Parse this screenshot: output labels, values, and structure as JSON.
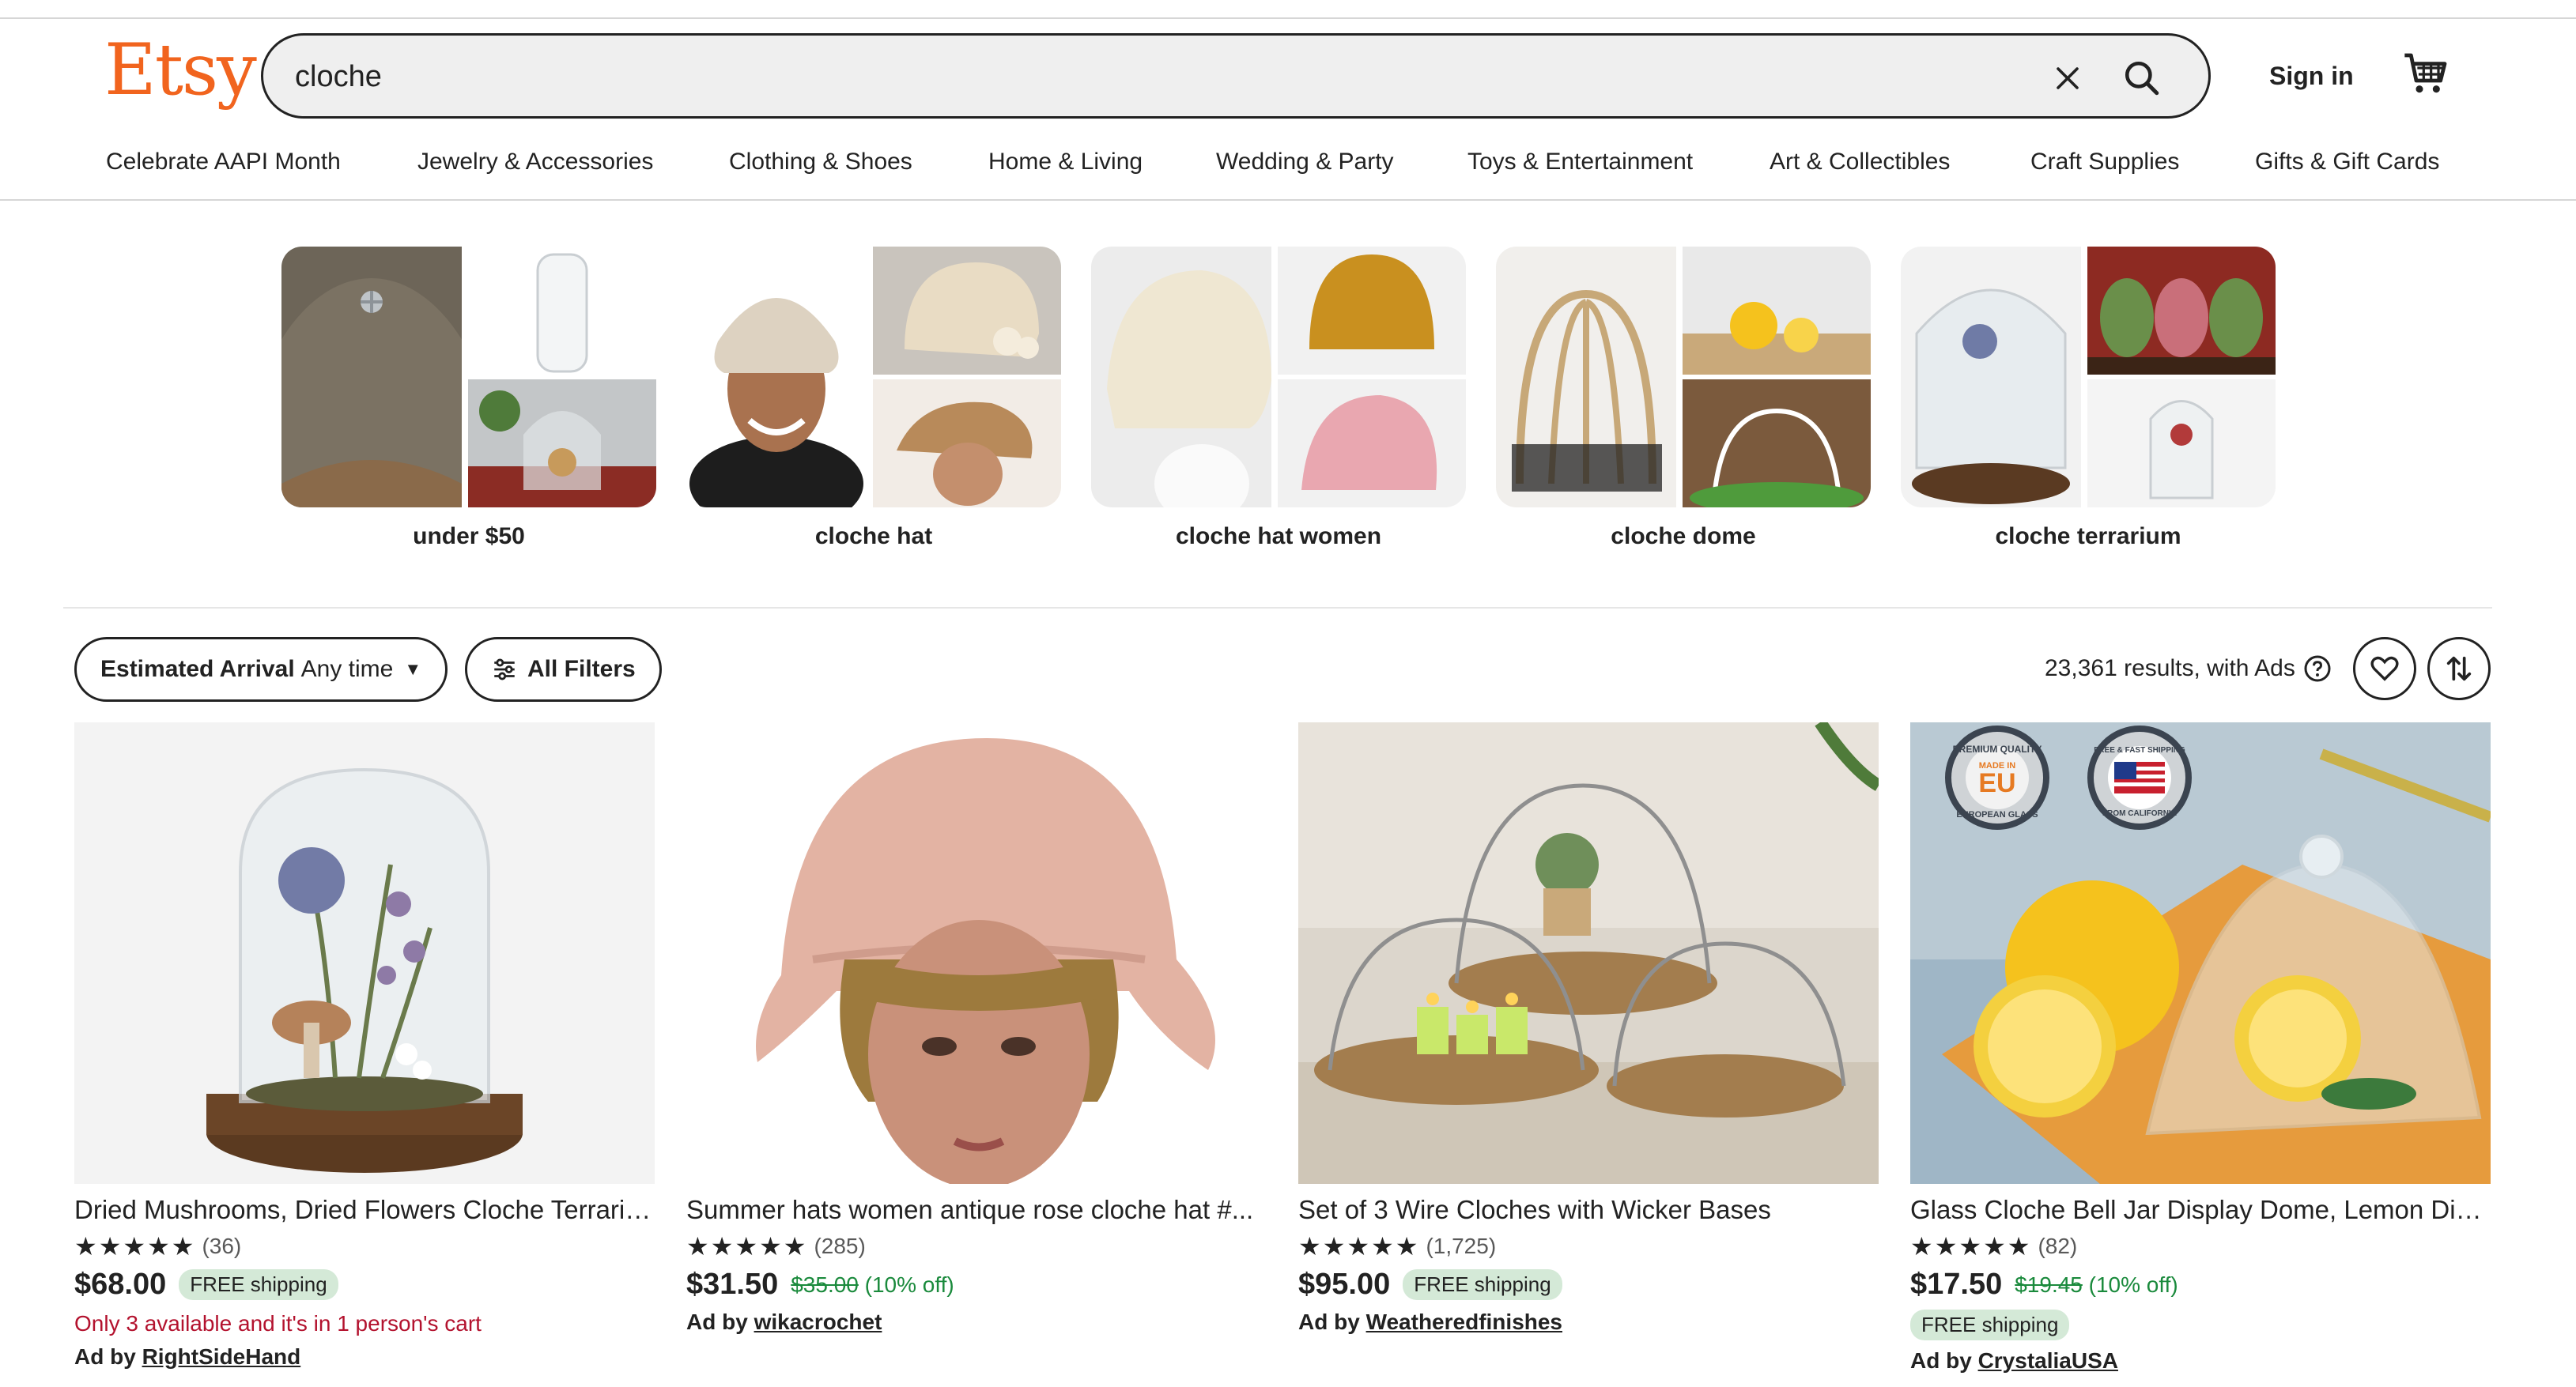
{
  "header": {
    "logo": "Etsy",
    "search_value": "cloche",
    "signin_label": "Sign in"
  },
  "categories": [
    "Celebrate AAPI Month",
    "Jewelry & Accessories",
    "Clothing & Shoes",
    "Home & Living",
    "Wedding & Party",
    "Toys & Entertainment",
    "Art & Collectibles",
    "Craft Supplies",
    "Gifts & Gift Cards"
  ],
  "related": [
    {
      "label": "under $50"
    },
    {
      "label": "cloche hat"
    },
    {
      "label": "cloche hat women"
    },
    {
      "label": "cloche dome"
    },
    {
      "label": "cloche terrarium"
    }
  ],
  "filters": {
    "arrival_label": "Estimated Arrival",
    "arrival_value": "Any time",
    "all_filters_label": "All Filters",
    "results_text": "23,361 results, with Ads"
  },
  "listings": [
    {
      "title": "Dried Mushrooms, Dried Flowers Cloche Terrarium",
      "stars": "★★★★★",
      "reviews": "(36)",
      "price": "$68.00",
      "original_price": "",
      "discount": "",
      "shipping": "FREE shipping",
      "scarcity": "Only 3 available and it's in 1 person's cart",
      "ad_prefix": "Ad by",
      "shop": "RightSideHand"
    },
    {
      "title": "Summer hats women antique rose cloche hat #...",
      "stars": "★★★★★",
      "reviews": "(285)",
      "price": "$31.50",
      "original_price": "$35.00",
      "discount": "(10% off)",
      "shipping": "",
      "scarcity": "",
      "ad_prefix": "Ad by",
      "shop": "wikacrochet"
    },
    {
      "title": "Set of 3 Wire Cloches with Wicker Bases",
      "stars": "★★★★★",
      "reviews": "(1,725)",
      "price": "$95.00",
      "original_price": "",
      "discount": "",
      "shipping": "FREE shipping",
      "scarcity": "",
      "ad_prefix": "Ad by",
      "shop": "Weatheredfinishes"
    },
    {
      "title": "Glass Cloche Bell Jar Display Dome, Lemon Display",
      "stars": "★★★★★",
      "reviews": "(82)",
      "price": "$17.50",
      "original_price": "$19.45",
      "discount": "(10% off)",
      "shipping": "FREE shipping",
      "scarcity": "",
      "ad_prefix": "Ad by",
      "shop": "CrystaliaUSA"
    }
  ],
  "badges": {
    "eu_text": "EU",
    "eu_top": "PREMIUM QUALITY",
    "eu_mid": "MADE IN",
    "eu_bottom": "EUROPEAN GLASS",
    "usa_top": "FREE & FAST SHIPPING",
    "usa_bottom": "FROM CALIFORNIA"
  },
  "colors": {
    "brand": "#f1641e",
    "free_shipping_bg": "#d4e9d7",
    "discount": "#1a8a3c",
    "scarcity": "#b3122e"
  },
  "icons": {
    "clear": "close-icon",
    "search": "search-icon",
    "cart": "cart-icon",
    "filter": "sliders-icon",
    "favorite": "heart-icon",
    "sort": "sort-icon",
    "help": "question-icon"
  }
}
